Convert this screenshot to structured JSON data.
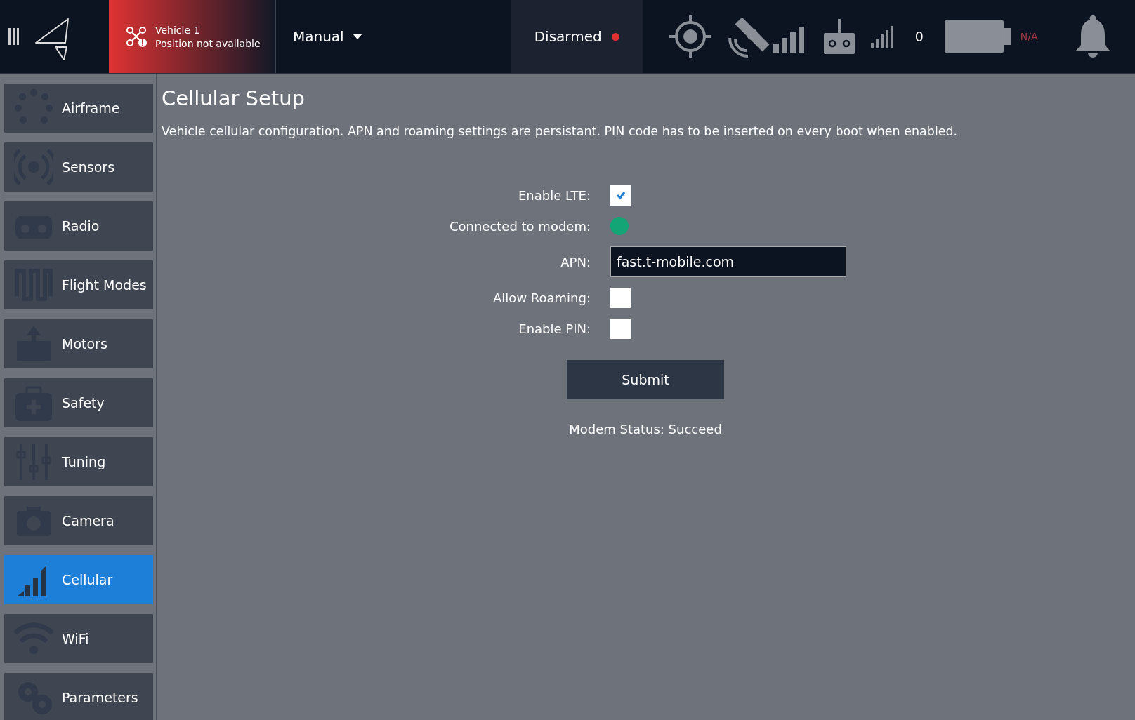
{
  "toolbar": {
    "vehicle": {
      "name": "Vehicle 1",
      "status": "Position not available"
    },
    "flight_mode": "Manual",
    "arm_status": {
      "label": "Disarmed",
      "armed": false
    },
    "rc_count": "0",
    "battery": {
      "reading": "N/A"
    }
  },
  "sidebar": {
    "items": [
      {
        "label": "Airframe",
        "kind": "airframe",
        "selected": false
      },
      {
        "label": "Sensors",
        "kind": "sensors",
        "selected": false
      },
      {
        "label": "Radio",
        "kind": "radio",
        "selected": false
      },
      {
        "label": "Flight Modes",
        "kind": "modes",
        "selected": false
      },
      {
        "label": "Motors",
        "kind": "motors",
        "selected": false
      },
      {
        "label": "Safety",
        "kind": "safety",
        "selected": false
      },
      {
        "label": "Tuning",
        "kind": "tuning",
        "selected": false
      },
      {
        "label": "Camera",
        "kind": "camera",
        "selected": false
      },
      {
        "label": "Cellular",
        "kind": "cellular",
        "selected": true
      },
      {
        "label": "WiFi",
        "kind": "wifi",
        "selected": false
      },
      {
        "label": "Parameters",
        "kind": "parameters",
        "selected": false
      }
    ]
  },
  "page": {
    "title": "Cellular Setup",
    "description": "Vehicle cellular configuration. APN and roaming settings are persistant. PIN code has to be inserted on every boot when enabled.",
    "fields": [
      {
        "label": "Enable LTE:",
        "kind": "checkbox",
        "checked": true
      },
      {
        "label": "Connected to modem:",
        "kind": "indicator",
        "on": true
      },
      {
        "label": "APN:",
        "kind": "text",
        "value": "fast.t-mobile.com"
      },
      {
        "label": "Allow Roaming:",
        "kind": "checkbox",
        "checked": false
      },
      {
        "label": "Enable PIN:",
        "kind": "checkbox",
        "checked": false
      }
    ],
    "submit": "Submit",
    "status": "Modem Status: Succeed"
  }
}
